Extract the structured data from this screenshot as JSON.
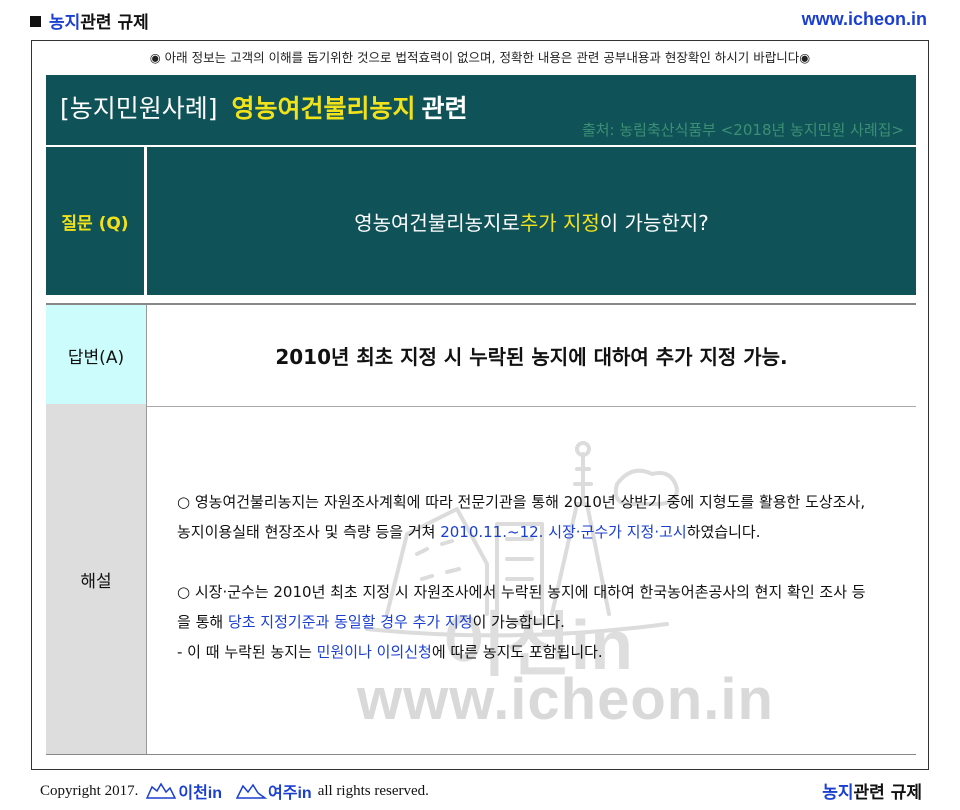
{
  "header": {
    "category_highlight": "농지",
    "category_rest": "관련 규제",
    "site": "www.icheon.in"
  },
  "notice": "◉ 아래 정보는 고객의 이해를 돕기위한 것으로 법적효력이 없으며, 정확한 내용은 관련 공부내용과 현장확인 하시기 바랍니다◉",
  "title": {
    "bracket": "[농지민원사례]",
    "topic": "영농여건불리농지",
    "suffix": "관련",
    "source": "출처: 농림축산식품부 <2018년 농지민원 사례집>"
  },
  "question": {
    "label": "질문 (Q)",
    "text_before": "영농여건불리농지로 ",
    "text_highlight": "추가 지정",
    "text_after": "이 가능한지?"
  },
  "answer": {
    "label": "답변(A)",
    "text": "2010년 최초 지정 시 누락된 농지에 대하여 추가 지정 가능."
  },
  "explanation": {
    "label": "해설",
    "p1_a": "○ 영농여건불리농지는 자원조사계획에 따라 전문기관을 통해 2010년 상반기 중에 지형도를 활용한 도상조사, 농지이용실태 현장조사 및 측량 등을 거쳐 ",
    "p1_hl": "2010.11.~12. 시장·군수가 지정·고시",
    "p1_b": "하였습니다.",
    "p2_a": "○ 시장·군수는 2010년 최초 지정 시 자원조사에서 누락된 농지에 대하여 한국농어촌공사의 현지 확인 조사 등을 통해 ",
    "p2_hl": "당초 지정기준과 동일할 경우 추가 지정",
    "p2_b": "이 가능합니다.",
    "p3_a": "- 이 때 누락된 농지는 ",
    "p3_hl": "민원이나 이의신청",
    "p3_b": "에 따른 농지도 포함됩니다.",
    "watermark": "www.icheon.in"
  },
  "footer": {
    "copyright": "Copyright 2017.",
    "logo1": "이천in",
    "logo2": "여주in",
    "rights": "all rights reserved.",
    "category_highlight": "농지",
    "category_rest": "관련 규제"
  },
  "colors": {
    "accent_blue": "#1a3fd1",
    "teal": "#0f5358",
    "yellow": "#f2e21a"
  }
}
